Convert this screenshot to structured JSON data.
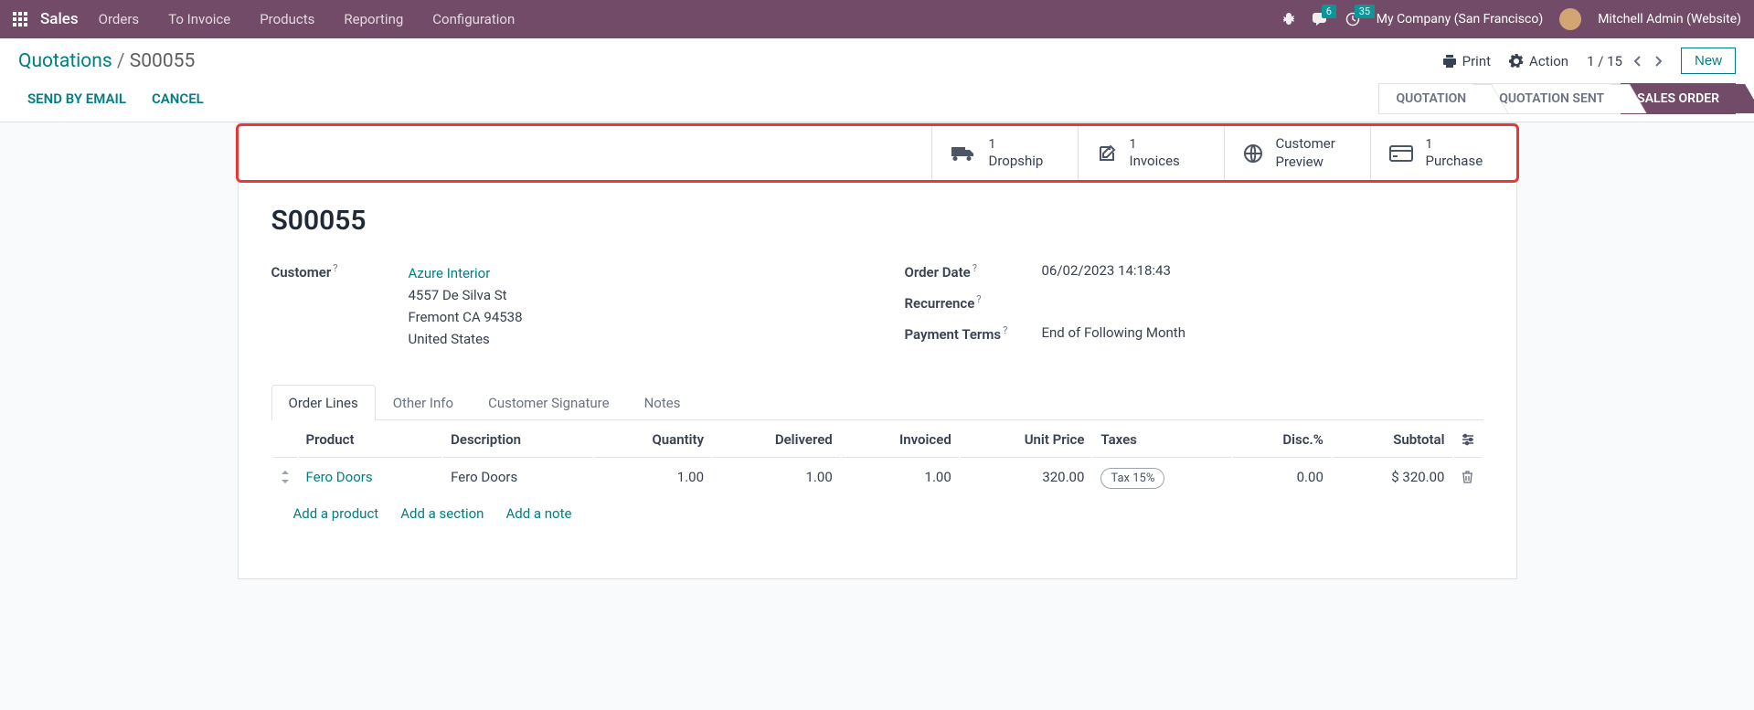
{
  "navbar": {
    "brand": "Sales",
    "menu": [
      "Orders",
      "To Invoice",
      "Products",
      "Reporting",
      "Configuration"
    ],
    "chat_count": "6",
    "activity_count": "35",
    "company": "My Company (San Francisco)",
    "user": "Mitchell Admin (Website)"
  },
  "breadcrumb": {
    "parent": "Quotations",
    "current": "S00055"
  },
  "control": {
    "print": "Print",
    "action": "Action",
    "pager": "1 / 15",
    "new": "New"
  },
  "actions": {
    "send": "SEND BY EMAIL",
    "cancel": "CANCEL"
  },
  "status": [
    "QUOTATION",
    "QUOTATION SENT",
    "SALES ORDER"
  ],
  "stats": {
    "dropship": {
      "count": "1",
      "label": "Dropship"
    },
    "invoices": {
      "count": "1",
      "label": "Invoices"
    },
    "preview": {
      "label1": "Customer",
      "label2": "Preview"
    },
    "purchase": {
      "count": "1",
      "label": "Purchase"
    }
  },
  "record": {
    "name": "S00055",
    "customer_label": "Customer",
    "customer": "Azure Interior",
    "addr1": "4557 De Silva St",
    "addr2": "Fremont CA 94538",
    "addr3": "United States",
    "order_date_label": "Order Date",
    "order_date": "06/02/2023 14:18:43",
    "recurrence_label": "Recurrence",
    "payment_terms_label": "Payment Terms",
    "payment_terms": "End of Following Month"
  },
  "tabs": [
    "Order Lines",
    "Other Info",
    "Customer Signature",
    "Notes"
  ],
  "table": {
    "headers": {
      "product": "Product",
      "description": "Description",
      "quantity": "Quantity",
      "delivered": "Delivered",
      "invoiced": "Invoiced",
      "unit_price": "Unit Price",
      "taxes": "Taxes",
      "disc": "Disc.%",
      "subtotal": "Subtotal"
    },
    "rows": [
      {
        "product": "Fero Doors",
        "description": "Fero Doors",
        "quantity": "1.00",
        "delivered": "1.00",
        "invoiced": "1.00",
        "unit_price": "320.00",
        "taxes": "Tax 15%",
        "disc": "0.00",
        "subtotal": "$ 320.00"
      }
    ]
  },
  "add": {
    "product": "Add a product",
    "section": "Add a section",
    "note": "Add a note"
  }
}
